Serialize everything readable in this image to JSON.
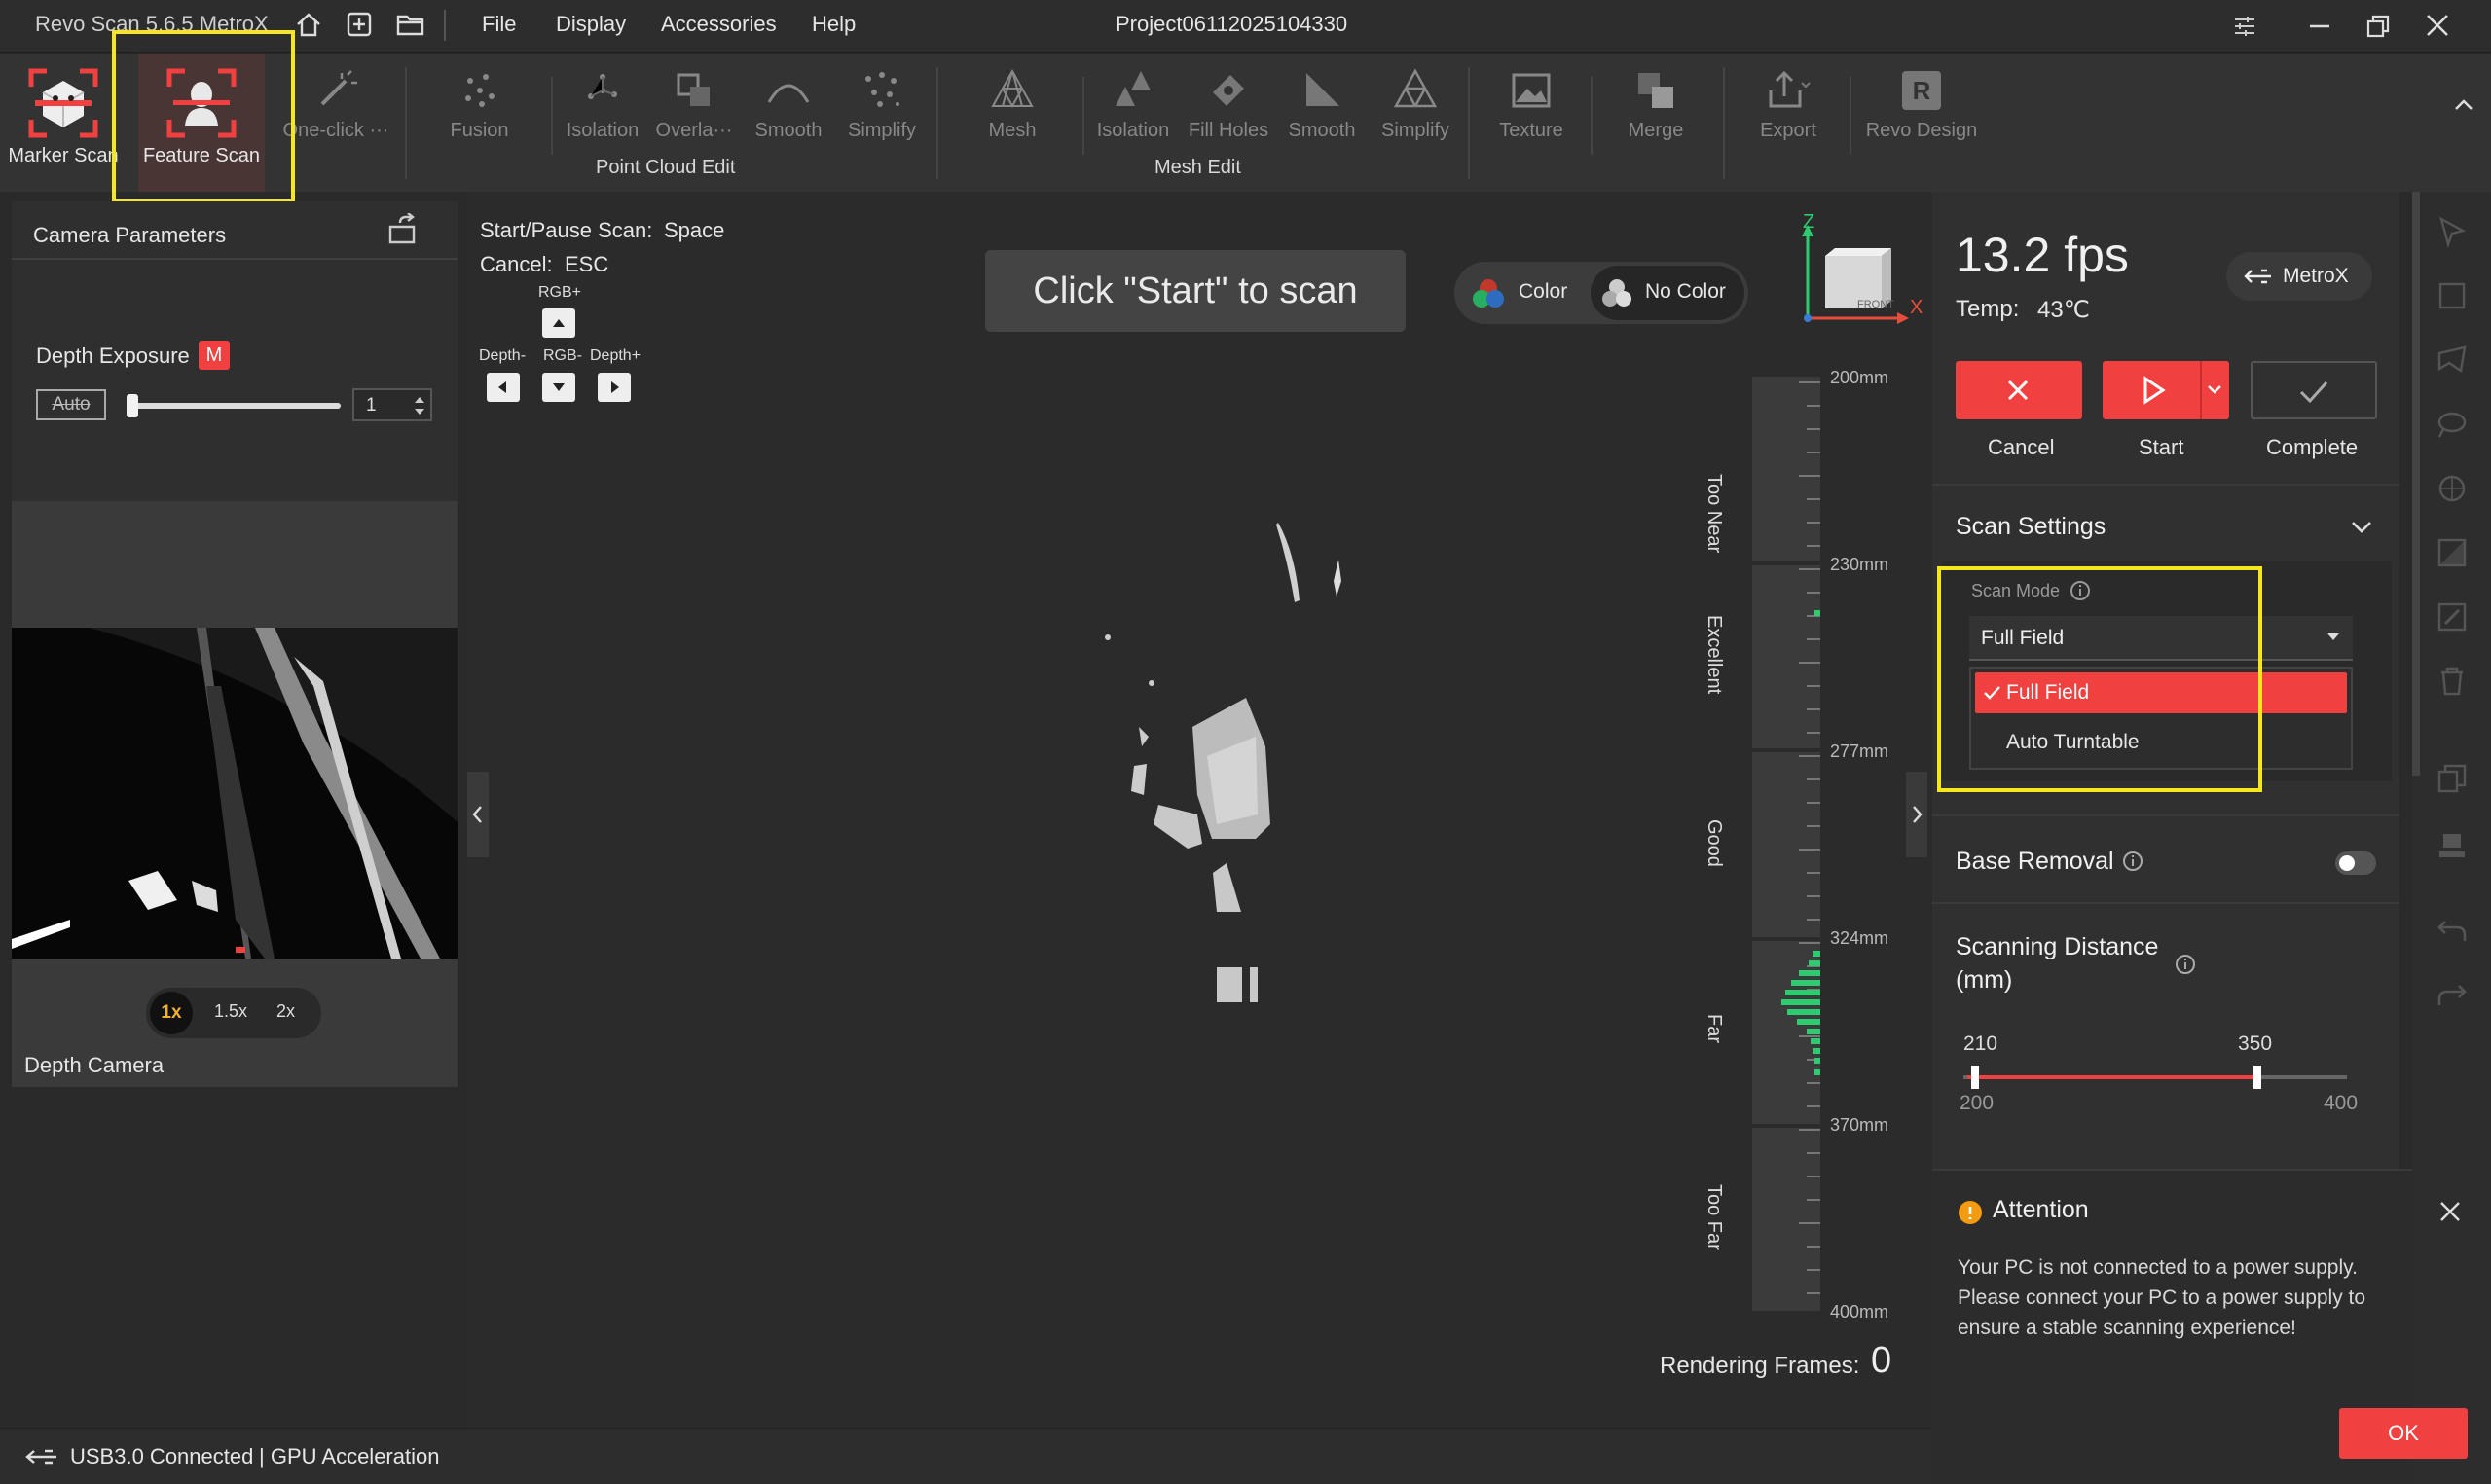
{
  "titlebar": {
    "app_name": "Revo Scan 5.6.5 MetroX",
    "menu": [
      "File",
      "Display",
      "Accessories",
      "Help"
    ],
    "project": "Project06112025104330"
  },
  "ribbon": {
    "marker_scan": "Marker Scan",
    "feature_scan": "Feature Scan",
    "one_click": "One-click ···",
    "pc_fusion": "Fusion",
    "pc_isolation": "Isolation",
    "pc_overlap": "Overla···",
    "pc_smooth": "Smooth",
    "pc_simplify": "Simplify",
    "point_cloud_edit": "Point Cloud Edit",
    "mesh": "Mesh",
    "m_isolation": "Isolation",
    "fill_holes": "Fill Holes",
    "m_smooth": "Smooth",
    "m_simplify": "Simplify",
    "mesh_edit": "Mesh Edit",
    "texture": "Texture",
    "merge": "Merge",
    "export": "Export",
    "revo_design": "Revo Design"
  },
  "left_panel": {
    "title": "Camera Parameters",
    "depth_exposure": "Depth Exposure",
    "mode_badge": "M",
    "auto": "Auto",
    "exposure_value": "1",
    "exposure_level": 0.0,
    "zoom_options": [
      "1x",
      "1.5x",
      "2x"
    ],
    "zoom_selected": "1x",
    "camera_label": "Depth Camera"
  },
  "viewport": {
    "hint_start_label": "Start/Pause Scan:",
    "hint_start_key": "Space",
    "hint_cancel_label": "Cancel:",
    "hint_cancel_key": "ESC",
    "rgb_plus": "RGB+",
    "depth_minus": "Depth-",
    "rgb_minus": "RGB-",
    "depth_plus": "Depth+",
    "banner": "Click \"Start\" to scan",
    "color": "Color",
    "no_color": "No Color",
    "axis_z": "Z",
    "axis_x": "X",
    "cube_face": "FRONT",
    "distance_ticks": [
      "200mm",
      "230mm",
      "277mm",
      "324mm",
      "370mm",
      "400mm"
    ],
    "distance_zones": [
      "Too Near",
      "Excellent",
      "Good",
      "Far",
      "Too Far"
    ],
    "rendering_label": "Rendering Frames:",
    "rendering_value": "0"
  },
  "right_panel": {
    "fps": "13.2 fps",
    "temp_label": "Temp:",
    "temp_value": "43℃",
    "device": "MetroX",
    "cancel": "Cancel",
    "start": "Start",
    "complete": "Complete",
    "scan_settings": "Scan Settings",
    "scan_mode_label": "Scan Mode",
    "scan_mode_value": "Full Field",
    "scan_mode_options": [
      "Full Field",
      "Auto Turntable"
    ],
    "base_removal": "Base Removal",
    "scanning_distance": "Scanning Distance",
    "mm_unit": "(mm)",
    "range_low": "210",
    "range_high": "350",
    "range_min": "200",
    "range_max": "400",
    "attention_title": "Attention",
    "attention_body": "Your PC is not connected to a power supply. Please connect your PC to a power supply to ensure a stable scanning experience!",
    "ok": "OK"
  },
  "status": {
    "usb": "USB3.0 Connected",
    "gpu": "| GPU Acceleration"
  },
  "colors": {
    "accent_red": "#f04040",
    "highlight_yellow": "#f5e61d",
    "gauge_green": "#2ecc71"
  }
}
